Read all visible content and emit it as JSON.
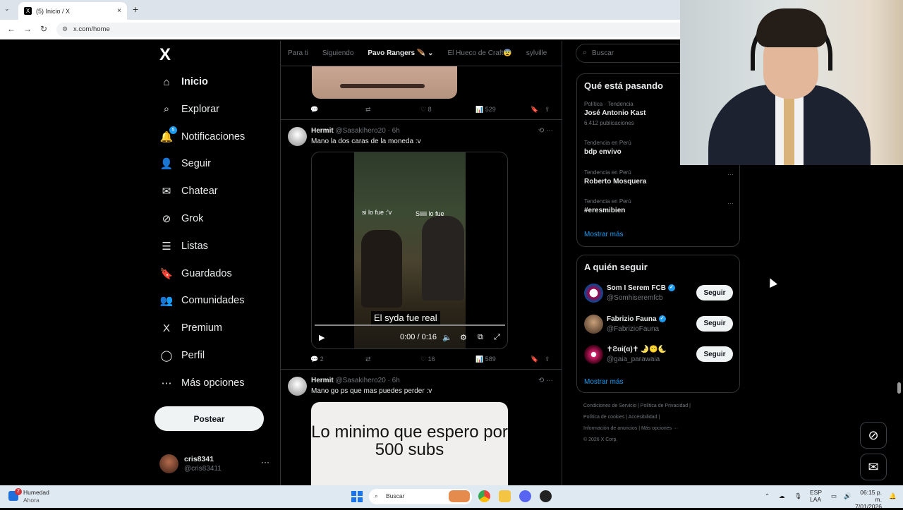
{
  "browser": {
    "tab_title": "(5) Inicio / X",
    "tab_close": "×",
    "new_tab": "+",
    "url": "x.com/home"
  },
  "sidebar": {
    "logo": "X",
    "items": [
      {
        "label": "Inicio",
        "icon": "⌂",
        "icon_name": "home-icon"
      },
      {
        "label": "Explorar",
        "icon": "⌕",
        "icon_name": "search-icon"
      },
      {
        "label": "Notificaciones",
        "icon": "🔔",
        "icon_name": "bell-icon",
        "badge": "5"
      },
      {
        "label": "Seguir",
        "icon": "👤",
        "icon_name": "add-person-icon"
      },
      {
        "label": "Chatear",
        "icon": "✉",
        "icon_name": "mail-icon"
      },
      {
        "label": "Grok",
        "icon": "⊘",
        "icon_name": "grok-icon"
      },
      {
        "label": "Listas",
        "icon": "☰",
        "icon_name": "list-icon"
      },
      {
        "label": "Guardados",
        "icon": "🔖",
        "icon_name": "bookmark-icon"
      },
      {
        "label": "Comunidades",
        "icon": "👥",
        "icon_name": "communities-icon"
      },
      {
        "label": "Premium",
        "icon": "X",
        "icon_name": "premium-icon"
      },
      {
        "label": "Perfil",
        "icon": "◯",
        "icon_name": "profile-icon"
      },
      {
        "label": "Más opciones",
        "icon": "⋯",
        "icon_name": "more-icon"
      }
    ],
    "post_button": "Postear",
    "account": {
      "name": "cris8341",
      "handle": "@cris83411",
      "more": "···"
    }
  },
  "timeline": {
    "tabs": [
      "Para ti",
      "Siguiendo",
      "Pavo Rangers 🪶 ⌄",
      "El Hueco de Craft😨",
      "sylville"
    ],
    "prev_post_actions": {
      "replies": "",
      "reposts": "",
      "likes": "8",
      "views": "529"
    },
    "posts": [
      {
        "name": "Hermit",
        "handle": "@Sasakihero20 · 6h",
        "text": "Mano la dos caras de la moneda :v",
        "video": {
          "caption_left": "si lo fue :'v",
          "caption_right": "Siiiii lo fue",
          "caption_bottom": "El syda fue real",
          "time": "0:00 / 0:16"
        },
        "actions": {
          "replies": "2",
          "reposts": "",
          "likes": "16",
          "views": "589"
        }
      },
      {
        "name": "Hermit",
        "handle": "@Sasakihero20 · 6h",
        "text": "Mano go ps que mas puedes perder :v",
        "image_text": "Lo minimo que espero por 500 subs"
      }
    ]
  },
  "right": {
    "search_placeholder": "Buscar",
    "trends_title": "Qué está pasando",
    "trends": [
      {
        "context": "Política · Tendencia",
        "name": "José Antonio Kast",
        "count": "6.412 publicaciones"
      },
      {
        "context": "Tendencia en Perú",
        "name": "bdp envivo",
        "count": ""
      },
      {
        "context": "Tendencia en Perú",
        "name": "Roberto Mosquera",
        "count": ""
      },
      {
        "context": "Tendencia en Perú",
        "name": "#eresmibien",
        "count": ""
      }
    ],
    "show_more": "Mostrar más",
    "who_title": "A quién seguir",
    "who": [
      {
        "name": "Som I Serem FCB",
        "handle": "@Somhiseremfcb",
        "verified": true,
        "button": "Seguir"
      },
      {
        "name": "Fabrizio Fauna",
        "handle": "@FabrizioFauna",
        "verified": true,
        "button": "Seguir"
      },
      {
        "name": "✝Ƨɑi(ɑ)✝ 🌛😶🌜",
        "handle": "@gaia_parawaia",
        "verified": false,
        "button": "Seguir"
      }
    ],
    "who_show_more": "Mostrar más",
    "footer": [
      "Condiciones de Servicio  |  Política de Privacidad  |",
      "Política de cookies  |  Accesibilidad  |",
      "Información de anuncios  |  Más opciones ···",
      "© 2026 X Corp."
    ]
  },
  "taskbar": {
    "weather_label": "Humedad",
    "weather_sub": "Ahora",
    "weather_badge": "2",
    "search": "Buscar",
    "lang": "ESP",
    "lang2": "LAA",
    "time": "06:15 p. m.",
    "date": "7/01/2026"
  }
}
